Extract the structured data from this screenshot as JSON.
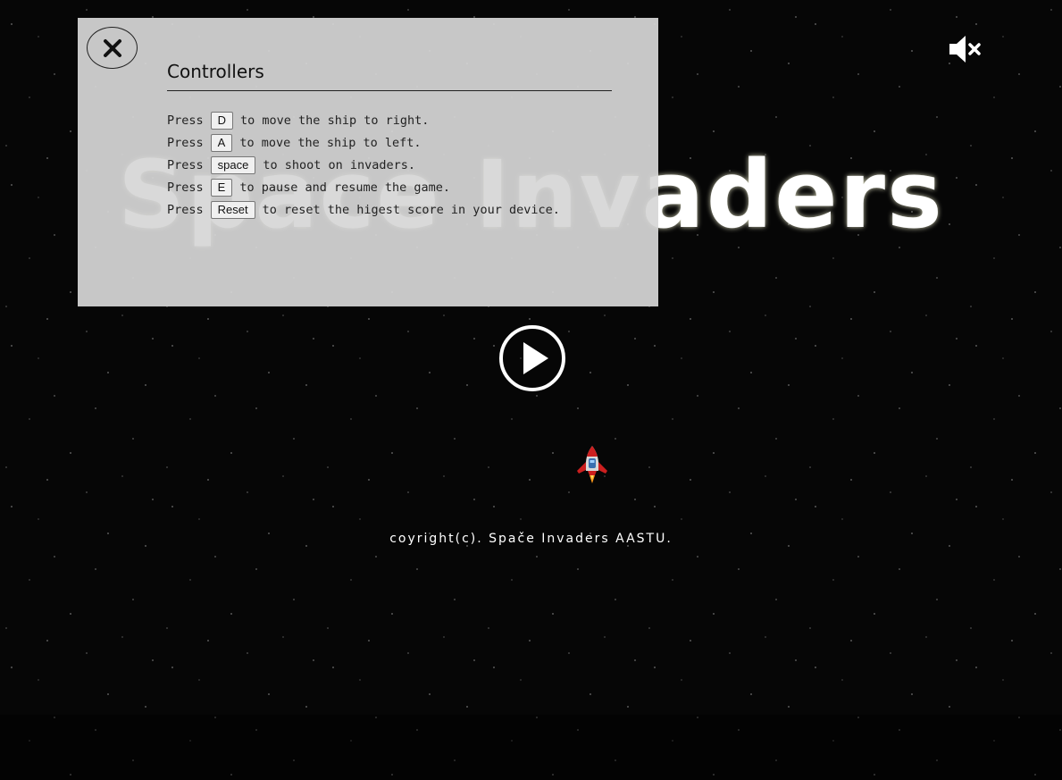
{
  "game": {
    "title": "Space Invaders",
    "copyright": "coyright(c). Spače Invaders AASTU."
  },
  "icons": {
    "mute": "volume-mute-icon",
    "close": "close-icon",
    "play": "play-icon",
    "ship": "rocket-ship-icon"
  },
  "controllers": {
    "heading": "Controllers",
    "rows": [
      {
        "prefix": "Press",
        "key": "D",
        "text": "to move the ship to right."
      },
      {
        "prefix": "Press",
        "key": "A",
        "text": "to move the ship to left."
      },
      {
        "prefix": "Press",
        "key": "space",
        "text": "to shoot on invaders."
      },
      {
        "prefix": "Press",
        "key": "E",
        "text": "to pause and resume the game."
      },
      {
        "prefix": "Press",
        "key": "Reset",
        "text": "to reset the higest score in your device."
      }
    ]
  },
  "colors": {
    "background": "#050505",
    "modal": "#d6d6d6",
    "ship_body": "#cc1f1f"
  }
}
